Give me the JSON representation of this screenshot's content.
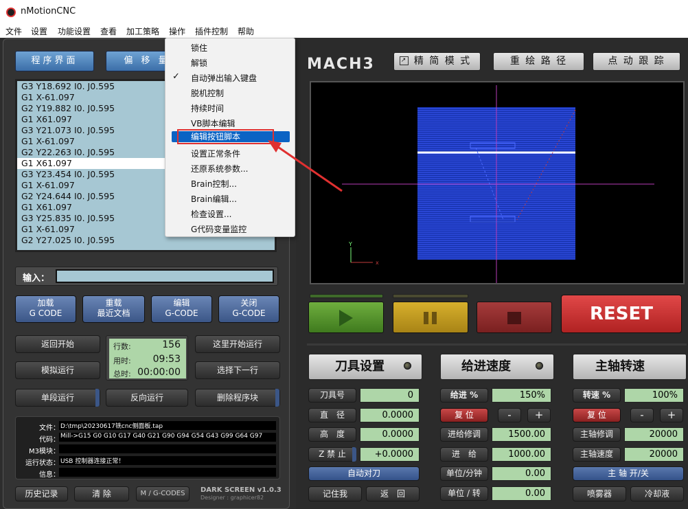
{
  "window": {
    "title": "nMotionCNC"
  },
  "menubar": [
    "文件",
    "设置",
    "功能设置",
    "查看",
    "加工策略",
    "操作",
    "插件控制",
    "帮助"
  ],
  "tabs": {
    "program": "程序界面",
    "offset": "偏 移 量"
  },
  "gcode_lines": [
    "G3 Y18.692 I0. J0.595",
    "G1 X-61.097",
    "G2 Y19.882 I0. J0.595",
    "G1 X61.097",
    "G3 Y21.073 I0. J0.595",
    "G1 X-61.097",
    "G2 Y22.263 I0. J0.595",
    "G1 X61.097",
    "G3 Y23.454 I0. J0.595",
    "G1 X-61.097",
    "G2 Y24.644 I0. J0.595",
    "G1 X61.097",
    "G3 Y25.835 I0. J0.595",
    "G1 X-61.097",
    "G2 Y27.025 I0. J0.595"
  ],
  "gcode_selected_index": 7,
  "input_label": "输入：",
  "left_buttons": {
    "load": [
      "加载",
      "G CODE"
    ],
    "reload": [
      "重载",
      "最近文档"
    ],
    "edit": [
      "编辑",
      "G-CODE"
    ],
    "close": [
      "关闭",
      "G-CODE"
    ],
    "rewind": "返回开始",
    "simulate": "模拟运行",
    "single": "单段运行",
    "run_from_here": "这里开始运行",
    "select_next": "选择下一行",
    "reverse": "反向运行",
    "delete_block": "删除程序块",
    "history": "历史记录",
    "clear": "清  除",
    "mgcodes": "M / G-CODES"
  },
  "counters": {
    "line_label": "行数:",
    "line_value": "156",
    "elapsed_label": "用时:",
    "elapsed_value": "09:53",
    "total_label": "总时:",
    "total_value": "00:00:00"
  },
  "status": {
    "file_label": "文件：",
    "file_value": "D:\\tmp\\20230617铣cnc侧面板.tap",
    "code_label": "代码：",
    "code_value": "Mill->G15  G0 G10 G17 G40 G21 G90 G94 G54 G43 G99 G64 G97",
    "m3_label": "M3模块：",
    "m3_value": "",
    "run_label": "运行状态：",
    "run_value": "USB 控制器连接正常！",
    "info_label": "信息：",
    "info_value": ""
  },
  "dark_screen": {
    "title": "DARK SCREEN v1.0.3",
    "designer": "Designer : graphicer82"
  },
  "dropdown": {
    "items": [
      "锁住",
      "解锁",
      "自动弹出输入键盘",
      "脱机控制",
      "持续时间",
      "VB脚本编辑",
      "编辑按钮脚本",
      "设置正常条件",
      "还原系统参数...",
      "Brain控制...",
      "Brain编辑...",
      "检查设置...",
      "G代码变量监控"
    ],
    "checked_index": 2,
    "highlight_index": 6
  },
  "header": {
    "logo": "MACH3",
    "fine_mode": "精 简 模 式",
    "regen": "重 绘 路 径",
    "jog": "点 动 跟 踪"
  },
  "controls": {
    "reset": "RESET"
  },
  "tool": {
    "title": "刀具设置",
    "number_label": "刀具号",
    "number_value": "0",
    "diameter_label": "直　径",
    "diameter_value": "0.0000",
    "height_label": "高　度",
    "height_value": "0.0000",
    "z_label": "Z 禁 止",
    "z_value": "+0.0000",
    "auto": "自动对刀",
    "remember": "记住我",
    "return": "返　回"
  },
  "feed": {
    "title": "给进速度",
    "pct_label": "给进 %",
    "pct_value": "150%",
    "reset": "复 位",
    "minus": "-",
    "plus": "+",
    "adjust_label": "进给修调",
    "adjust_value": "1500.00",
    "feed_label": "进　给",
    "feed_value": "1000.00",
    "unit_min_label": "单位/分钟",
    "unit_min_value": "0.00",
    "unit_rev_label": "单位 / 转",
    "unit_rev_value": "0.00"
  },
  "spindle": {
    "title": "主轴转速",
    "pct_label": "转速 %",
    "pct_value": "100%",
    "reset": "复 位",
    "minus": "-",
    "plus": "+",
    "adjust_label": "主轴修调",
    "adjust_value": "20000",
    "speed_label": "主轴速度",
    "speed_value": "20000",
    "toggle": "主 轴 开/关",
    "mist": "喷雾器",
    "coolant": "冷却液"
  }
}
